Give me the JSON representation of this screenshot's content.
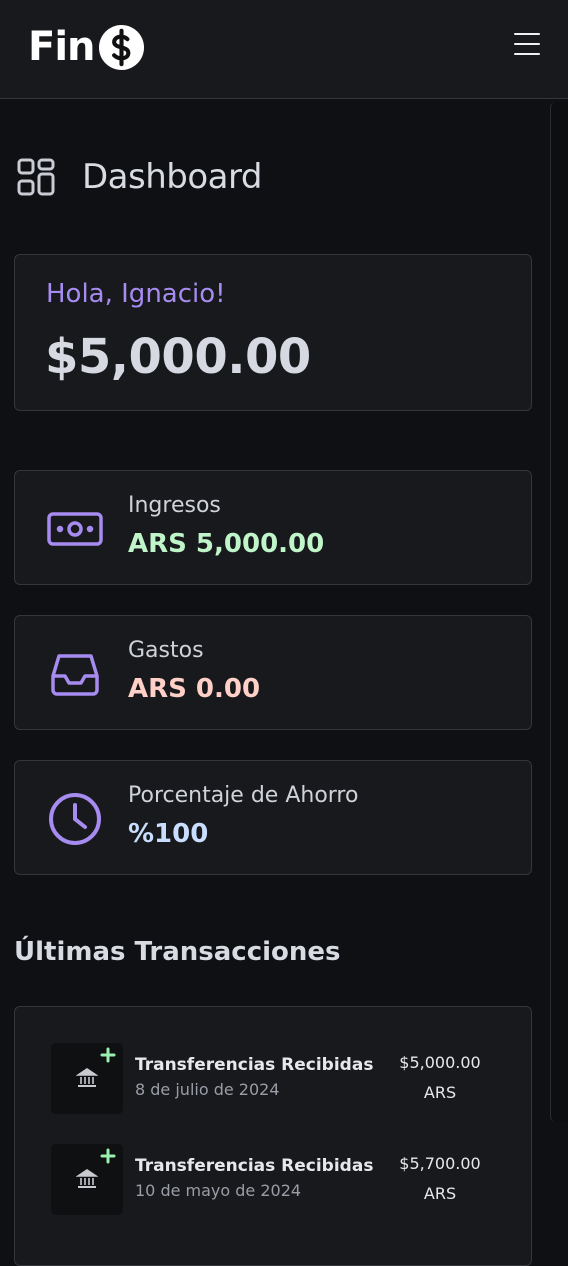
{
  "header": {
    "logo_text": "Fin",
    "logo_icon": "dollar-coin-icon",
    "menu_icon": "hamburger-menu-icon"
  },
  "page": {
    "title": "Dashboard",
    "icon": "dashboard-grid-icon"
  },
  "balance": {
    "greeting": "Hola, Ignacio!",
    "amount": "$5,000.00"
  },
  "stats": [
    {
      "label": "Ingresos",
      "value": "ARS 5,000.00",
      "icon": "cash-icon",
      "color": "#bff5c9"
    },
    {
      "label": "Gastos",
      "value": "ARS 0.00",
      "icon": "inbox-tray-icon",
      "color": "#ffd0c8"
    },
    {
      "label": "Porcentaje de Ahorro",
      "value": "%100",
      "icon": "clock-icon",
      "color": "#c9ddff"
    }
  ],
  "transactions": {
    "title": "Últimas Transacciones",
    "items": [
      {
        "name": "Transferencias Recibidas",
        "date": "8 de julio de 2024",
        "amount": "$5,000.00",
        "currency": "ARS",
        "icon": "bank-icon"
      },
      {
        "name": "Transferencias Recibidas",
        "date": "10 de mayo de 2024",
        "amount": "$5,700.00",
        "currency": "ARS",
        "icon": "bank-icon"
      }
    ]
  },
  "colors": {
    "accent": "#a68bf0",
    "income": "#bff5c9",
    "expense": "#ffd0c8",
    "savings": "#c9ddff",
    "plus": "#9af0ae"
  }
}
